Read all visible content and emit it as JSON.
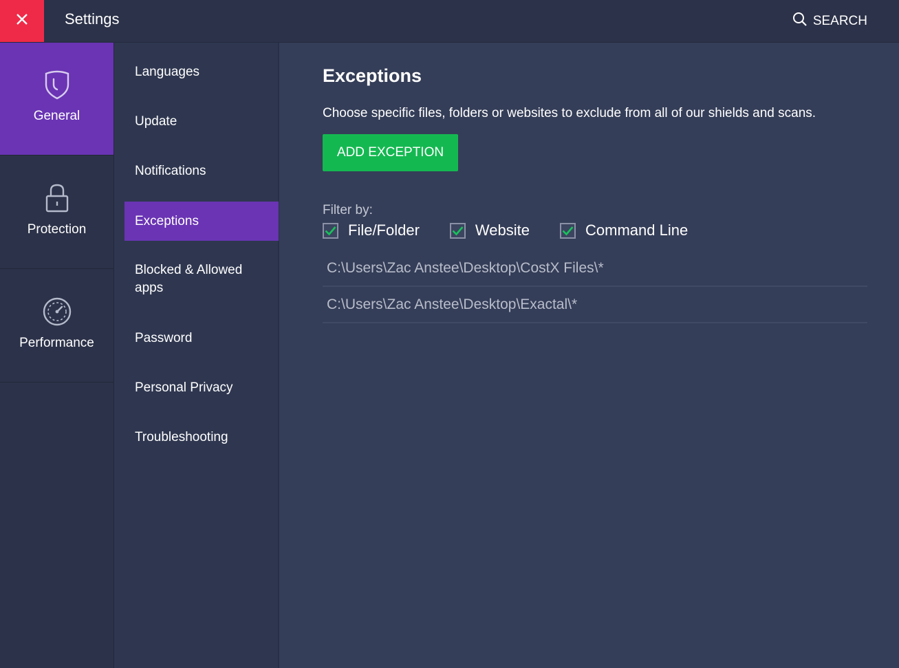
{
  "titlebar": {
    "title": "Settings",
    "search_label": "SEARCH",
    "close_color": "#ef2a48"
  },
  "categories": [
    {
      "label": "General",
      "icon": "shield-icon",
      "active": true
    },
    {
      "label": "Protection",
      "icon": "lock-icon",
      "active": false
    },
    {
      "label": "Performance",
      "icon": "speedometer-icon",
      "active": false
    }
  ],
  "submenu": {
    "items": [
      {
        "label": "Languages"
      },
      {
        "label": "Update"
      },
      {
        "label": "Notifications"
      },
      {
        "label": "Exceptions",
        "active": true
      },
      {
        "label": "Blocked & Allowed apps"
      },
      {
        "label": "Password"
      },
      {
        "label": "Personal Privacy"
      },
      {
        "label": "Troubleshooting"
      }
    ]
  },
  "main": {
    "title": "Exceptions",
    "description": "Choose specific files, folders or websites to exclude from all of our shields and scans.",
    "add_button_label": "ADD EXCEPTION",
    "filter_label": "Filter by:",
    "filters": [
      {
        "label": "File/Folder",
        "checked": true
      },
      {
        "label": "Website",
        "checked": true
      },
      {
        "label": "Command Line",
        "checked": true
      }
    ],
    "exceptions": [
      "C:\\Users\\Zac Anstee\\Desktop\\CostX Files\\*",
      "C:\\Users\\Zac Anstee\\Desktop\\Exactal\\*"
    ]
  },
  "colors": {
    "accent_purple": "#6a34b4",
    "button_green": "#14b851",
    "check_green": "#17c45a"
  }
}
